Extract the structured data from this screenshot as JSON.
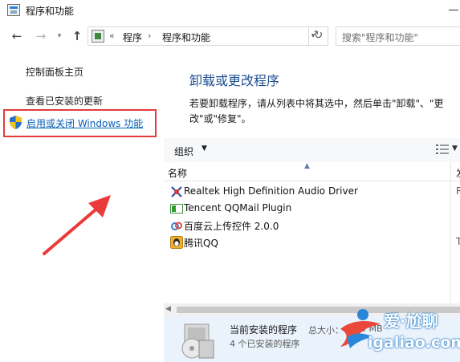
{
  "window": {
    "title": "程序和功能"
  },
  "address": {
    "breadcrumb_prefix": "«",
    "segments": [
      "程序",
      "程序和功能"
    ],
    "search_placeholder": "搜索\"程序和功能\""
  },
  "left_pane": {
    "home": "控制面板主页",
    "updates": "查看已安装的更新",
    "features": "启用或关闭 Windows 功能"
  },
  "main": {
    "heading": "卸载或更改程序",
    "description": "若要卸载程序，请从列表中将其选中，然后单击\"卸载\"、\"更改\"或\"修复\"。",
    "organize": "组织",
    "columns": {
      "name": "名称",
      "next": "发"
    },
    "programs": [
      {
        "name": "Realtek High Definition Audio Driver",
        "icon": "realtek-icon",
        "extra": "R"
      },
      {
        "name": "Tencent QQMail Plugin",
        "icon": "qqmail-plugin-icon",
        "extra": ""
      },
      {
        "name": "百度云上传控件 2.0.0",
        "icon": "baidu-cloud-icon",
        "extra": ""
      },
      {
        "name": "腾讯QQ",
        "icon": "qq-icon",
        "extra": "T"
      }
    ]
  },
  "details": {
    "title": "当前安装的程序",
    "size_label": "总大小：",
    "size_value": "89 MB",
    "count": "4 个已安装的程序"
  },
  "watermark": {
    "top": "爱·尬聊",
    "bottom": "igaliao.com"
  },
  "colors": {
    "accent": "#1e4f91",
    "link": "#0a5fb5",
    "highlight_box": "#e53b3b"
  }
}
